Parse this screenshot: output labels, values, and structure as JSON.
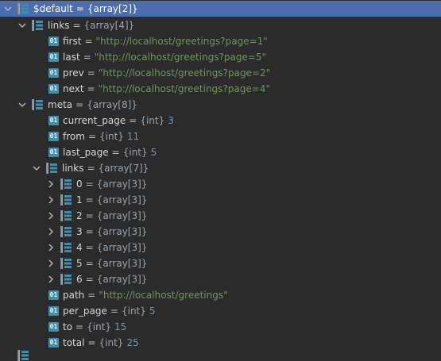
{
  "colors": {
    "background": "#2b2b2b",
    "selection": "#4b6eaf",
    "string": "#6a9a55",
    "number": "#6897bb",
    "icon": "#3d8fb2"
  },
  "icons": {
    "primitive_badge": "01"
  },
  "tree": {
    "root": {
      "name": "$default",
      "eq": "=",
      "type": "{array[2]}"
    },
    "links": {
      "name": "links",
      "eq": "=",
      "type": "{array[4]}",
      "first": {
        "name": "first",
        "eq": "=",
        "value": "\"http://localhost/greetings?page=1\""
      },
      "last": {
        "name": "last",
        "eq": "=",
        "value": "\"http://localhost/greetings?page=5\""
      },
      "prev": {
        "name": "prev",
        "eq": "=",
        "value": "\"http://localhost/greetings?page=2\""
      },
      "next": {
        "name": "next",
        "eq": "=",
        "value": "\"http://localhost/greetings?page=4\""
      }
    },
    "meta": {
      "name": "meta",
      "eq": "=",
      "type": "{array[8]}",
      "current_page": {
        "name": "current_page",
        "eq": "=",
        "type": "{int}",
        "value": "3"
      },
      "from": {
        "name": "from",
        "eq": "=",
        "type": "{int}",
        "value": "11"
      },
      "last_page": {
        "name": "last_page",
        "eq": "=",
        "type": "{int}",
        "value": "5"
      },
      "links": {
        "name": "links",
        "eq": "=",
        "type": "{array[7]}",
        "items": [
          {
            "name": "0",
            "eq": "=",
            "type": "{array[3]}"
          },
          {
            "name": "1",
            "eq": "=",
            "type": "{array[3]}"
          },
          {
            "name": "2",
            "eq": "=",
            "type": "{array[3]}"
          },
          {
            "name": "3",
            "eq": "=",
            "type": "{array[3]}"
          },
          {
            "name": "4",
            "eq": "=",
            "type": "{array[3]}"
          },
          {
            "name": "5",
            "eq": "=",
            "type": "{array[3]}"
          },
          {
            "name": "6",
            "eq": "=",
            "type": "{array[3]}"
          }
        ]
      },
      "path": {
        "name": "path",
        "eq": "=",
        "value": "\"http://localhost/greetings\""
      },
      "per_page": {
        "name": "per_page",
        "eq": "=",
        "type": "{int}",
        "value": "5"
      },
      "to": {
        "name": "to",
        "eq": "=",
        "type": "{int}",
        "value": "15"
      },
      "total": {
        "name": "total",
        "eq": "=",
        "type": "{int}",
        "value": "25"
      }
    }
  }
}
